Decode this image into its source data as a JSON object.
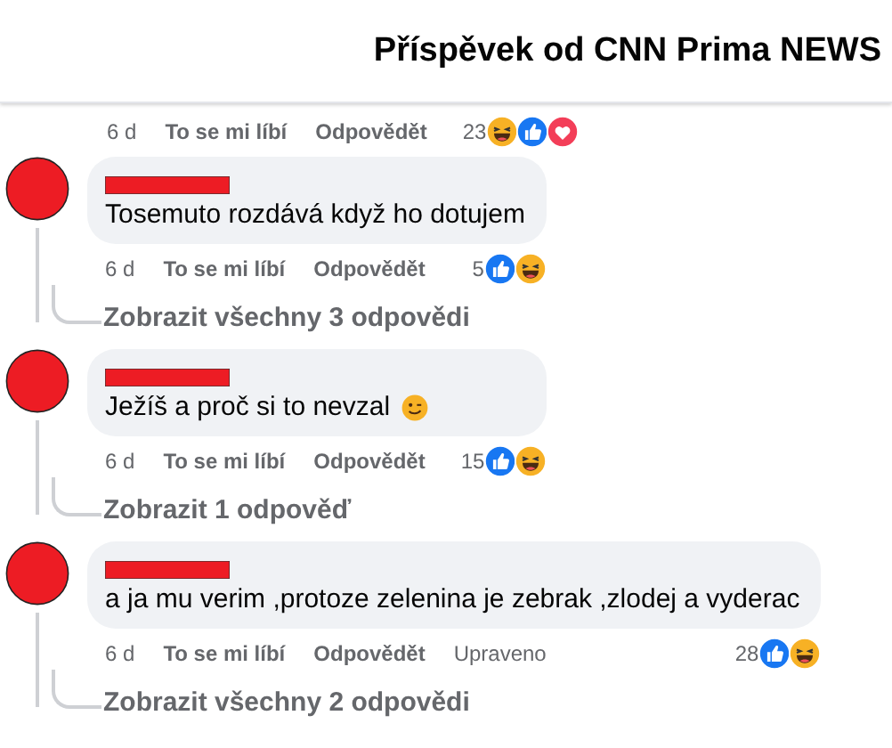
{
  "header": {
    "title": "Příspěvek od CNN Prima NEWS"
  },
  "previous_actions": {
    "time": "6 d",
    "like": "To se mi líbí",
    "reply": "Odpovědět",
    "count": "23",
    "reactions": [
      {
        "kind": "haha"
      },
      {
        "kind": "like"
      },
      {
        "kind": "love"
      }
    ]
  },
  "comments": [
    {
      "text": "Tosemuto rozdává když ho dotujem",
      "time": "6 d",
      "like": "To se mi líbí",
      "reply": "Odpovědět",
      "count": "5",
      "reactions": [
        {
          "kind": "like"
        },
        {
          "kind": "haha"
        }
      ],
      "replies_link": "Zobrazit všechny 3 odpovědi"
    },
    {
      "text": "Ježíš a proč si to nevzal",
      "emoji": {
        "kind": "wink"
      },
      "time": "6 d",
      "like": "To se mi líbí",
      "reply": "Odpovědět",
      "count": "15",
      "reactions": [
        {
          "kind": "like"
        },
        {
          "kind": "haha"
        }
      ],
      "replies_link": "Zobrazit 1 odpověď"
    },
    {
      "text": "a ja mu verim ,protoze zelenina je zebrak ,zlodej a vyderac",
      "time": "6 d",
      "like": "To se mi líbí",
      "reply": "Odpovědět",
      "edited": "Upraveno",
      "count": "28",
      "reactions": [
        {
          "kind": "like"
        },
        {
          "kind": "haha"
        }
      ],
      "replies_link": "Zobrazit všechny 2 odpovědi"
    }
  ]
}
